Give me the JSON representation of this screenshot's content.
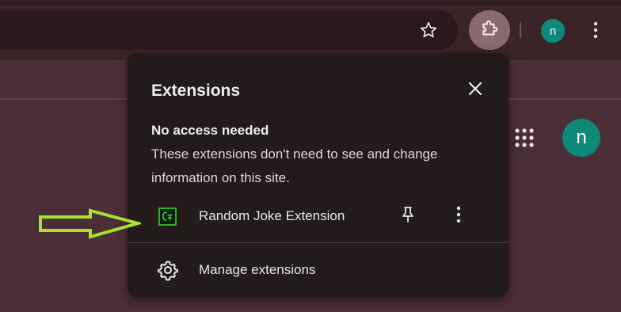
{
  "toolbar": {
    "profile_initial": "n"
  },
  "page": {
    "profile_initial": "n"
  },
  "popup": {
    "title": "Extensions",
    "section_heading": "No access needed",
    "section_description": "These extensions don't need to see and change information on this site.",
    "extensions": [
      {
        "name": "Random Joke Extension",
        "icon": "random-joke-logo"
      }
    ],
    "manage_label": "Manage extensions"
  },
  "colors": {
    "annotation_arrow": "#a6e22e",
    "avatar": "#0e8a7a",
    "popup_bg": "#221a1b"
  }
}
